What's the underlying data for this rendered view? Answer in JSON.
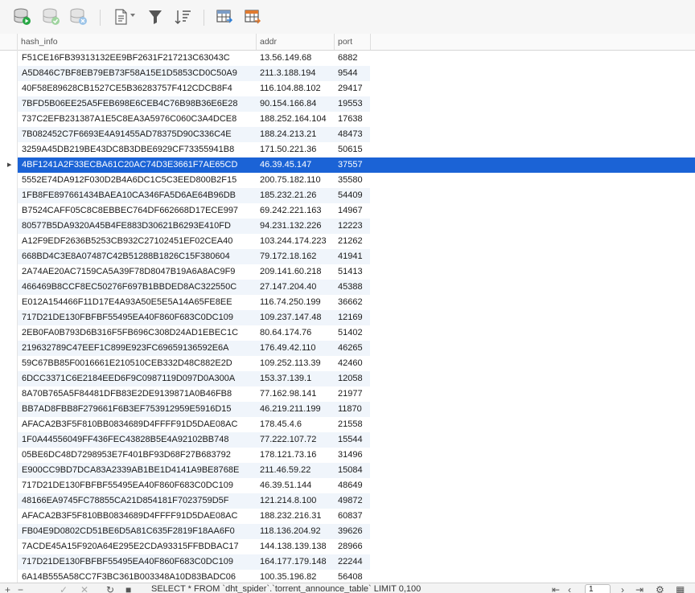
{
  "toolbar": {
    "icons": [
      "database-run-icon",
      "database-check-icon",
      "database-stop-icon",
      "document-icon",
      "filter-icon",
      "sort-icon",
      "table-import-icon",
      "table-export-icon"
    ]
  },
  "grid": {
    "columns": [
      "hash_info",
      "addr",
      "port"
    ],
    "selected_row": 7,
    "rows": [
      [
        "F51CE16FB39313132EE9BF2631F217213C63043C",
        "13.56.149.68",
        "6882"
      ],
      [
        "A5D846C7BF8EB79EB73F58A15E1D5853CD0C50A9",
        "211.3.188.194",
        "9544"
      ],
      [
        "40F58E89628CB1527CE5B36283757F412CDCB8F4",
        "116.104.88.102",
        "29417"
      ],
      [
        "7BFD5B06EE25A5FEB698E6CEB4C76B98B36E6E28",
        "90.154.166.84",
        "19553"
      ],
      [
        "737C2EFB231387A1E5C8EA3A5976C060C3A4DCE8",
        "188.252.164.104",
        "17638"
      ],
      [
        "7B082452C7F6693E4A91455AD78375D90C336C4E",
        "188.24.213.21",
        "48473"
      ],
      [
        "3259A45DB219BE43DC8B3DBE6929CF73355941B8",
        "171.50.221.36",
        "50615"
      ],
      [
        "4BF1241A2F33ECBA61C20AC74D3E3661F7AE65CD",
        "46.39.45.147",
        "37557"
      ],
      [
        "5552E74DA912F030D2B4A6DC1C5C3EED800B2F15",
        "200.75.182.110",
        "35580"
      ],
      [
        "1FB8FE897661434BAEA10CA346FA5D6AE64B96DB",
        "185.232.21.26",
        "54409"
      ],
      [
        "B7524CAFF05C8C8EBBEC764DF662668D17ECE997",
        "69.242.221.163",
        "14967"
      ],
      [
        "80577B5DA9320A45B4FE883D30621B6293E410FD",
        "94.231.132.226",
        "12223"
      ],
      [
        "A12F9EDF2636B5253CB932C27102451EF02CEA40",
        "103.244.174.223",
        "21262"
      ],
      [
        "668BD4C3E8A07487C42B51288B1826C15F380604",
        "79.172.18.162",
        "41941"
      ],
      [
        "2A74AE20AC7159CA5A39F78D8047B19A6A8AC9F9",
        "209.141.60.218",
        "51413"
      ],
      [
        "466469B8CCF8EC50276F697B1BBDED8AC322550C",
        "27.147.204.40",
        "45388"
      ],
      [
        "E012A154466F11D17E4A93A50E5E5A14A65FE8EE",
        "116.74.250.199",
        "36662"
      ],
      [
        "717D21DE130FBFBF55495EA40F860F683C0DC109",
        "109.237.147.48",
        "12169"
      ],
      [
        "2EB0FA0B793D6B316F5FB696C308D24AD1EBEC1C",
        "80.64.174.76",
        "51402"
      ],
      [
        "219632789C47EEF1C899E923FC69659136592E6A",
        "176.49.42.110",
        "46265"
      ],
      [
        "59C67BB85F0016661E210510CEB332D48C882E2D",
        "109.252.113.39",
        "42460"
      ],
      [
        "6DCC3371C6E2184EED6F9C0987119D097D0A300A",
        "153.37.139.1",
        "12058"
      ],
      [
        "8A70B765A5F84481DFB83E2DE9139871A0B46FB8",
        "77.162.98.141",
        "21977"
      ],
      [
        "BB7AD8FBB8F279661F6B3EF753912959E5916D15",
        "46.219.211.199",
        "11870"
      ],
      [
        "AFACA2B3F5F810BB0834689D4FFFF91D5DAE08AC",
        "178.45.4.6",
        "21558"
      ],
      [
        "1F0A44556049FF436FEC43828B5E4A92102BB748",
        "77.222.107.72",
        "15544"
      ],
      [
        "05BE6DC48D7298953E7F401BF93D68F27B683792",
        "178.121.73.16",
        "31496"
      ],
      [
        "E900CC9BD7DCA83A2339AB1BE1D4141A9BE8768E",
        "211.46.59.22",
        "15084"
      ],
      [
        "717D21DE130FBFBF55495EA40F860F683C0DC109",
        "46.39.51.144",
        "48649"
      ],
      [
        "48166EA9745FC78855CA21D854181F7023759D5F",
        "121.214.8.100",
        "49872"
      ],
      [
        "AFACA2B3F5F810BB0834689D4FFFF91D5DAE08AC",
        "188.232.216.31",
        "60837"
      ],
      [
        "FB04E9D0802CD51BE6D5A81C635F2819F18AA6F0",
        "118.136.204.92",
        "39626"
      ],
      [
        "7ACDE45A15F920A64E295E2CDA93315FFBDBAC17",
        "144.138.139.138",
        "28966"
      ],
      [
        "717D21DE130FBFBF55495EA40F860F683C0DC109",
        "164.177.179.148",
        "22244"
      ],
      [
        "6A14B555A58CC7F3BC361B003348A10D83BADC06",
        "100.35.196.82",
        "56408"
      ]
    ]
  },
  "status": {
    "sql": "SELECT * FROM `dht_spider`.`torrent_announce_table` LIMIT 0,100",
    "page": "1"
  }
}
